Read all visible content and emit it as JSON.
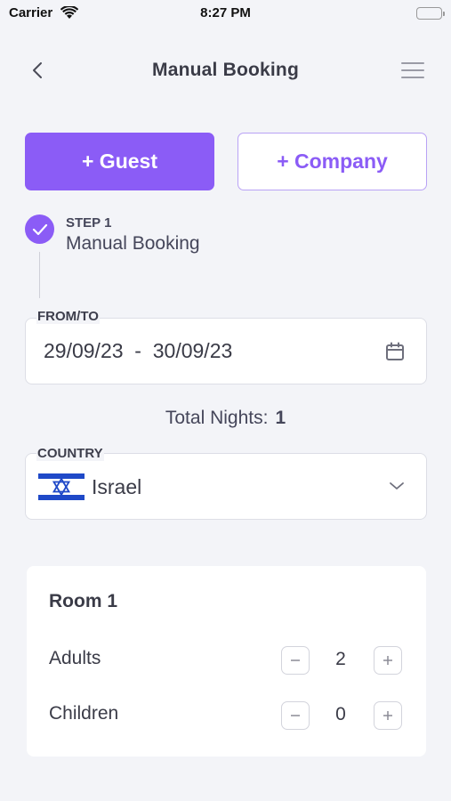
{
  "status_bar": {
    "carrier": "Carrier",
    "time": "8:27 PM"
  },
  "nav": {
    "title": "Manual Booking",
    "back_icon": "chevron-left-icon",
    "menu_icon": "hamburger-menu-icon"
  },
  "actions": {
    "guest_label": "+ Guest",
    "company_label": "+ Company"
  },
  "step": {
    "label": "STEP 1",
    "title": "Manual Booking",
    "completed": true
  },
  "dates": {
    "label": "FROM/TO",
    "value": "29/09/23  -  30/09/23",
    "icon": "calendar-icon"
  },
  "nights": {
    "label": "Total Nights:",
    "value": "1"
  },
  "country": {
    "label": "COUNTRY",
    "value": "Israel",
    "flag_icon": "israel-flag-icon",
    "dropdown_icon": "chevron-down-icon"
  },
  "room": {
    "title": "Room 1",
    "adults": {
      "label": "Adults",
      "count": "2"
    },
    "children": {
      "label": "Children",
      "count": "0"
    }
  },
  "colors": {
    "accent": "#8b5cf6",
    "background": "#f3f4f8",
    "flag_blue": "#1f49c8"
  }
}
